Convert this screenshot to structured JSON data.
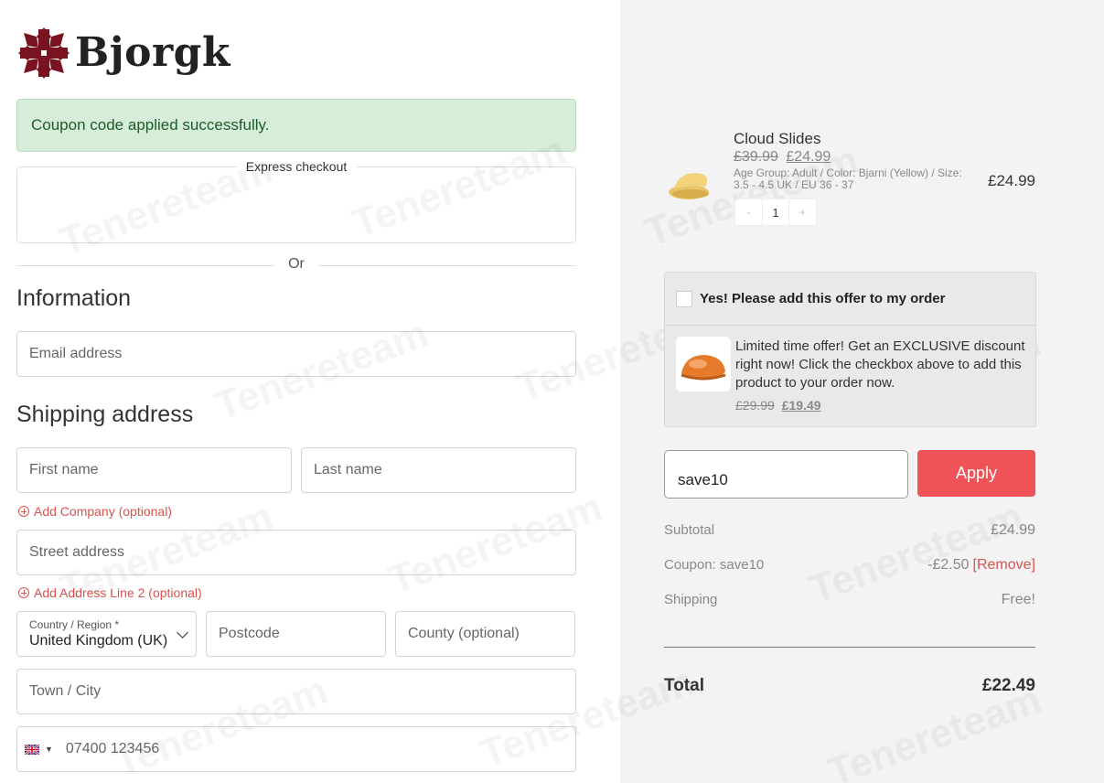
{
  "brand": {
    "name": "Bjorgk",
    "logo_color": "#7a1320"
  },
  "notice": {
    "text": "Coupon code applied successfully.",
    "bg": "#d6eed9",
    "color": "#1f5a2a"
  },
  "express": {
    "label": "Express checkout"
  },
  "divider_or": "Or",
  "information": {
    "heading": "Information",
    "email_placeholder": "Email address"
  },
  "shipping": {
    "heading": "Shipping address",
    "first_name_placeholder": "First name",
    "last_name_placeholder": "Last name",
    "add_company": "Add Company (optional)",
    "street_placeholder": "Street address",
    "add_line2": "Add Address Line 2 (optional)",
    "country_label": "Country / Region *",
    "country_value": "United Kingdom (UK)",
    "postcode_placeholder": "Postcode",
    "county_placeholder": "County (optional)",
    "town_placeholder": "Town / City",
    "phone_placeholder": "07400 123456",
    "phone_flag": "gb-flag-icon"
  },
  "cart": {
    "product": {
      "name": "Cloud Slides",
      "old_price": "£39.99",
      "new_price": "£24.99",
      "meta": "Age Group: Adult / Color: Bjarni (Yellow) / Size: 3.5 - 4.5 UK / EU 36 - 37",
      "line_price": "£24.99",
      "quantity": "1",
      "minus": "-",
      "plus": "+"
    },
    "offer": {
      "checkbox_label": "Yes! Please add this offer to my order",
      "text": "Limited time offer! Get an EXCLUSIVE discount right now! Click the checkbox above to add this product to your order now.",
      "old_price": "£29.99",
      "new_price": "£19.49"
    },
    "coupon": {
      "value": "save10",
      "apply_label": "Apply",
      "accent": "#ef5358"
    },
    "summary": {
      "subtotal_label": "Subtotal",
      "subtotal_value": "£24.99",
      "coupon_label": "Coupon: save10",
      "coupon_value": "-£2.50",
      "remove_label": "[Remove]",
      "shipping_label": "Shipping",
      "shipping_value": "Free!",
      "total_label": "Total",
      "total_value": "£22.49"
    }
  }
}
